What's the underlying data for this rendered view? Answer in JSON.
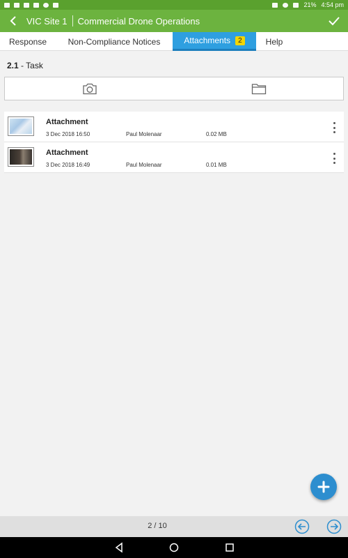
{
  "status_bar": {
    "battery": "21%",
    "time": "4:54 pm"
  },
  "appbar": {
    "site": "VIC Site 1",
    "project": "Commercial Drone Operations"
  },
  "tabs": [
    {
      "label": "Response"
    },
    {
      "label": "Non-Compliance Notices"
    },
    {
      "label": "Attachments",
      "badge": "2",
      "active": true
    },
    {
      "label": "Help"
    }
  ],
  "section": {
    "number": "2.1",
    "separator": "-",
    "name": "Task"
  },
  "attachments": [
    {
      "title": "Attachment",
      "date": "3 Dec 2018 16:50",
      "author": "Paul Molenaar",
      "size": "0.02 MB"
    },
    {
      "title": "Attachment",
      "date": "3 Dec 2018 16:49",
      "author": "Paul Molenaar",
      "size": "0.01 MB"
    }
  ],
  "footer": {
    "page_count": "2 / 10"
  },
  "colors": {
    "appbar": "#6cb33f",
    "active_tab": "#2e9fe0",
    "badge": "#f2d500",
    "fab": "#2d8ecf"
  }
}
